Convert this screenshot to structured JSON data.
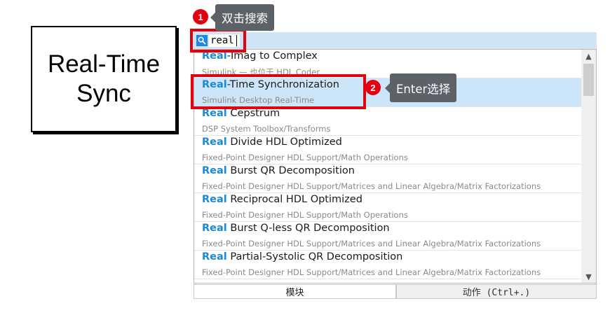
{
  "block": {
    "line1": "Real-Time",
    "line2": "Sync"
  },
  "search": {
    "value": "real",
    "icon": "search-icon"
  },
  "results": [
    {
      "highlight": "Real",
      "rest": "-Imag to Complex",
      "subtitle": "Simulink — 也位于 HDL Coder"
    },
    {
      "highlight": "Real",
      "rest": "-Time Synchronization",
      "subtitle": "Simulink Desktop Real-Time",
      "selected": true
    },
    {
      "highlight": "Real",
      "rest": " Cepstrum",
      "subtitle": "DSP System Toolbox/Transforms"
    },
    {
      "highlight": "Real",
      "rest": " Divide HDL Optimized",
      "subtitle": "Fixed-Point Designer HDL Support/Math Operations"
    },
    {
      "highlight": "Real",
      "rest": " Burst QR Decomposition",
      "subtitle": "Fixed-Point Designer HDL Support/Matrices and Linear Algebra/Matrix Factorizations"
    },
    {
      "highlight": "Real",
      "rest": " Reciprocal HDL Optimized",
      "subtitle": "Fixed-Point Designer HDL Support/Math Operations"
    },
    {
      "highlight": "Real",
      "rest": " Burst Q-less QR Decomposition",
      "subtitle": "Fixed-Point Designer HDL Support/Matrices and Linear Algebra/Matrix Factorizations"
    },
    {
      "highlight": "Real",
      "rest": " Partial-Systolic QR Decomposition",
      "subtitle": "Fixed-Point Designer HDL Support/Matrices and Linear Algebra/Matrix Factorizations"
    }
  ],
  "tabs": {
    "blocks": "模块",
    "actions": "动作 (Ctrl+.)"
  },
  "annotations": {
    "step1": {
      "number": "1",
      "text": "双击搜索"
    },
    "step2": {
      "number": "2",
      "text": "Enter选择"
    }
  },
  "colors": {
    "highlight": "#1a8ad8",
    "annotation_red": "#e5000f",
    "selection": "#cde5f8",
    "tooltip": "#5d6168"
  }
}
